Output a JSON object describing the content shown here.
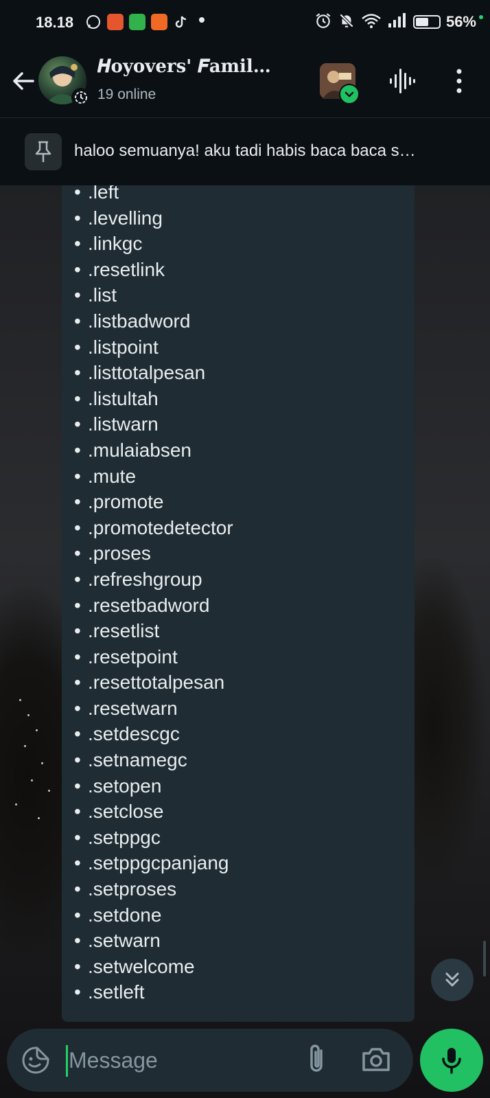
{
  "status_bar": {
    "time": "18.18",
    "battery": "56%",
    "icons": [
      "whatsapp-icon",
      "app-icon",
      "app-icon",
      "app-icon",
      "tiktok-icon",
      "alarm-icon",
      "mute-bell-icon",
      "wifi-icon",
      "signal-icon",
      "battery-icon"
    ]
  },
  "header": {
    "title": "𝑯oyovers' 𝑭amil…",
    "subtitle": "19 online"
  },
  "pinned": {
    "text": "haloo semuanya! aku tadi habis baca baca s…"
  },
  "commands": [
    ".left",
    ".levelling",
    ".linkgc",
    ".resetlink",
    ".list",
    ".listbadword",
    ".listpoint",
    ".listtotalpesan",
    ".listultah",
    ".listwarn",
    ".mulaiabsen",
    ".mute",
    ".promote",
    ".promotedetector",
    ".proses",
    ".refreshgroup",
    ".resetbadword",
    ".resetlist",
    ".resetpoint",
    ".resettotalpesan",
    ".resetwarn",
    ".setdescgc",
    ".setnamegc",
    ".setopen",
    ".setclose",
    ".setppgc",
    ".setppgcpanjang",
    ".setproses",
    ".setdone",
    ".setwarn",
    ".setwelcome",
    ".setleft"
  ],
  "input": {
    "placeholder": "Message"
  },
  "colors": {
    "accent": "#21c063",
    "bubble": "#1f2c33",
    "background": "#0b1014"
  }
}
